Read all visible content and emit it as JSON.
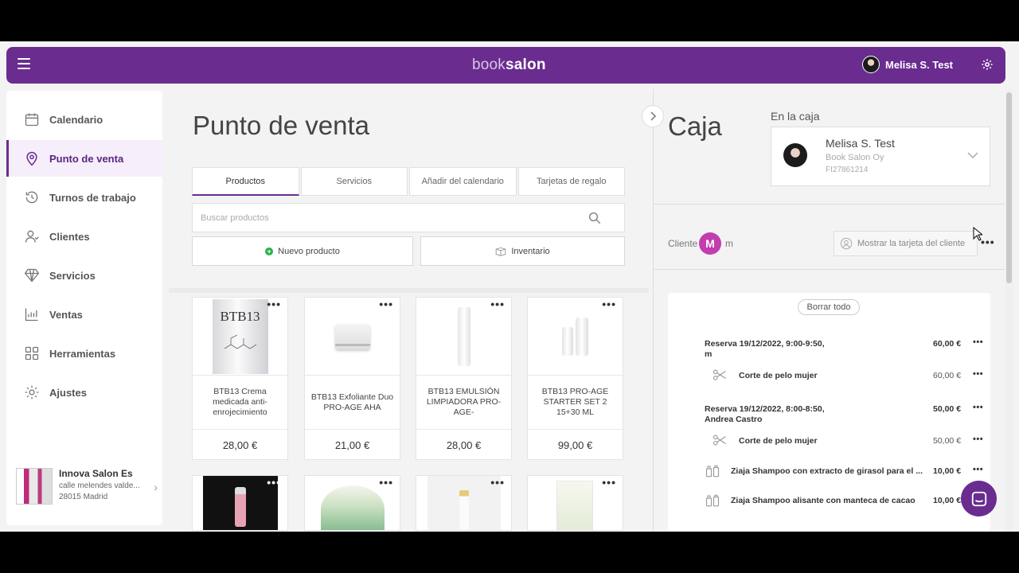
{
  "topbar": {
    "logo_part1": "book",
    "logo_part2": "salon",
    "user_name": "Melisa S. Test"
  },
  "sidebar": {
    "items": [
      {
        "label": "Calendario",
        "icon": "calendar-icon"
      },
      {
        "label": "Punto de venta",
        "icon": "location-pin-icon",
        "active": true
      },
      {
        "label": "Turnos de trabajo",
        "icon": "history-icon"
      },
      {
        "label": "Clientes",
        "icon": "user-icon"
      },
      {
        "label": "Servicios",
        "icon": "diamond-icon"
      },
      {
        "label": "Ventas",
        "icon": "chart-icon"
      },
      {
        "label": "Herramientas",
        "icon": "grid-icon"
      },
      {
        "label": "Ajustes",
        "icon": "gear-icon"
      }
    ],
    "salon": {
      "name": "Innova Salon Es",
      "address": "calle melendes valde...",
      "city": "28015 Madrid"
    }
  },
  "main": {
    "title": "Punto de venta",
    "tabs": [
      "Productos",
      "Servicios",
      "Añadir del calendario",
      "Tarjetas de regalo"
    ],
    "search_placeholder": "Buscar productos",
    "new_product": "Nuevo producto",
    "inventory": "Inventario",
    "products": [
      {
        "name": "BTB13 Crema medicada anti-enrojecimiento",
        "price": "28,00 €",
        "img_text": "BTB13"
      },
      {
        "name": "BTB13 Exfoliante Duo PRO-AGE AHA",
        "price": "21,00 €"
      },
      {
        "name": "BTB13 EMULSIÓN LIMPIADORA PRO-AGE-",
        "price": "28,00 €"
      },
      {
        "name": "BTB13 PRO-AGE STARTER SET 2 15+30 ML",
        "price": "99,00 €"
      }
    ]
  },
  "panel": {
    "title": "Caja",
    "in_register_label": "En la caja",
    "cashier": {
      "name": "Melisa S. Test",
      "company": "Book Salon Oy",
      "id": "FI27861214"
    },
    "client_label": "Cliente",
    "client_initial": "M",
    "client_name": "m",
    "show_card": "Mostrar la tarjeta del cliente",
    "clear_all": "Borrar todo",
    "lines": [
      {
        "title": "Reserva 19/12/2022, 9:00-9:50,",
        "title2": "m",
        "amount": "60,00 €"
      },
      {
        "title": "Corte de pelo mujer",
        "amount": "60,00 €"
      },
      {
        "title": "Reserva 19/12/2022, 8:00-8:50,",
        "title2": "Andrea Castro",
        "amount": "50,00 €"
      },
      {
        "title": "Corte de pelo mujer",
        "amount": "50,00 €"
      },
      {
        "title": "Ziaja Shampoo con extracto de girasol para el ...",
        "amount": "10,00 €"
      },
      {
        "title": "Ziaja Shampoo alisante con manteca de cacao",
        "amount": "10,00 €"
      }
    ]
  },
  "colors": {
    "brand": "#6a2c8f",
    "client_avatar": "#c23dae",
    "success": "#2bae4a"
  }
}
